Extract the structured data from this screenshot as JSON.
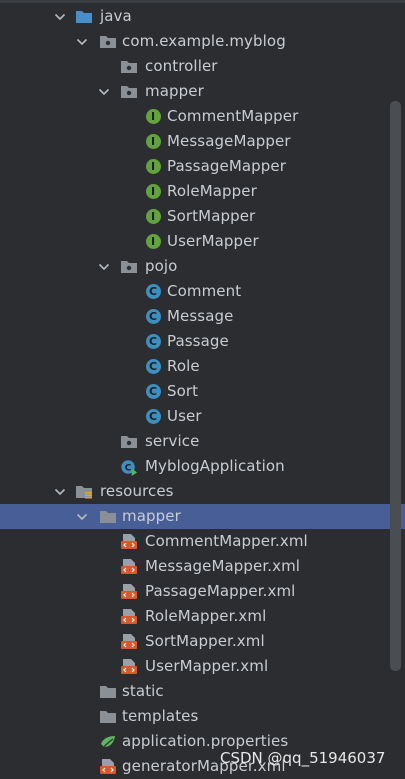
{
  "colors": {
    "background": "#2b2d30",
    "selection": "#485e96",
    "text": "#c9cdd2",
    "interface_badge": "#62a33e",
    "class_badge": "#3d8fbf",
    "xml_badge": "#d8582c",
    "folder": "#8a9096",
    "source_folder": "#4a8ec8"
  },
  "tree": {
    "items": [
      {
        "label": "java",
        "icon": "source-folder-icon",
        "expanded": true
      },
      {
        "label": "com.example.myblog",
        "icon": "package-icon",
        "expanded": true
      },
      {
        "label": "controller",
        "icon": "package-icon"
      },
      {
        "label": "mapper",
        "icon": "package-icon",
        "expanded": true
      },
      {
        "label": "CommentMapper",
        "icon": "interface-icon",
        "badge": "I"
      },
      {
        "label": "MessageMapper",
        "icon": "interface-icon",
        "badge": "I"
      },
      {
        "label": "PassageMapper",
        "icon": "interface-icon",
        "badge": "I"
      },
      {
        "label": "RoleMapper",
        "icon": "interface-icon",
        "badge": "I"
      },
      {
        "label": "SortMapper",
        "icon": "interface-icon",
        "badge": "I"
      },
      {
        "label": "UserMapper",
        "icon": "interface-icon",
        "badge": "I"
      },
      {
        "label": "pojo",
        "icon": "package-icon",
        "expanded": true
      },
      {
        "label": "Comment",
        "icon": "class-icon",
        "badge": "C"
      },
      {
        "label": "Message",
        "icon": "class-icon",
        "badge": "C"
      },
      {
        "label": "Passage",
        "icon": "class-icon",
        "badge": "C"
      },
      {
        "label": "Role",
        "icon": "class-icon",
        "badge": "C"
      },
      {
        "label": "Sort",
        "icon": "class-icon",
        "badge": "C"
      },
      {
        "label": "User",
        "icon": "class-icon",
        "badge": "C"
      },
      {
        "label": "service",
        "icon": "package-icon"
      },
      {
        "label": "MyblogApplication",
        "icon": "spring-boot-class-icon"
      },
      {
        "label": "resources",
        "icon": "resources-folder-icon",
        "expanded": true
      },
      {
        "label": "mapper",
        "icon": "folder-icon",
        "expanded": true,
        "selected": true
      },
      {
        "label": "CommentMapper.xml",
        "icon": "xml-file-icon"
      },
      {
        "label": "MessageMapper.xml",
        "icon": "xml-file-icon"
      },
      {
        "label": "PassageMapper.xml",
        "icon": "xml-file-icon"
      },
      {
        "label": "RoleMapper.xml",
        "icon": "xml-file-icon"
      },
      {
        "label": "SortMapper.xml",
        "icon": "xml-file-icon"
      },
      {
        "label": "UserMapper.xml",
        "icon": "xml-file-icon"
      },
      {
        "label": "static",
        "icon": "folder-icon"
      },
      {
        "label": "templates",
        "icon": "folder-icon"
      },
      {
        "label": "application.properties",
        "icon": "properties-file-icon"
      },
      {
        "label": "generatorMapper.xml",
        "icon": "xml-file-icon"
      }
    ]
  },
  "watermark": "CSDN @qq_51946037"
}
